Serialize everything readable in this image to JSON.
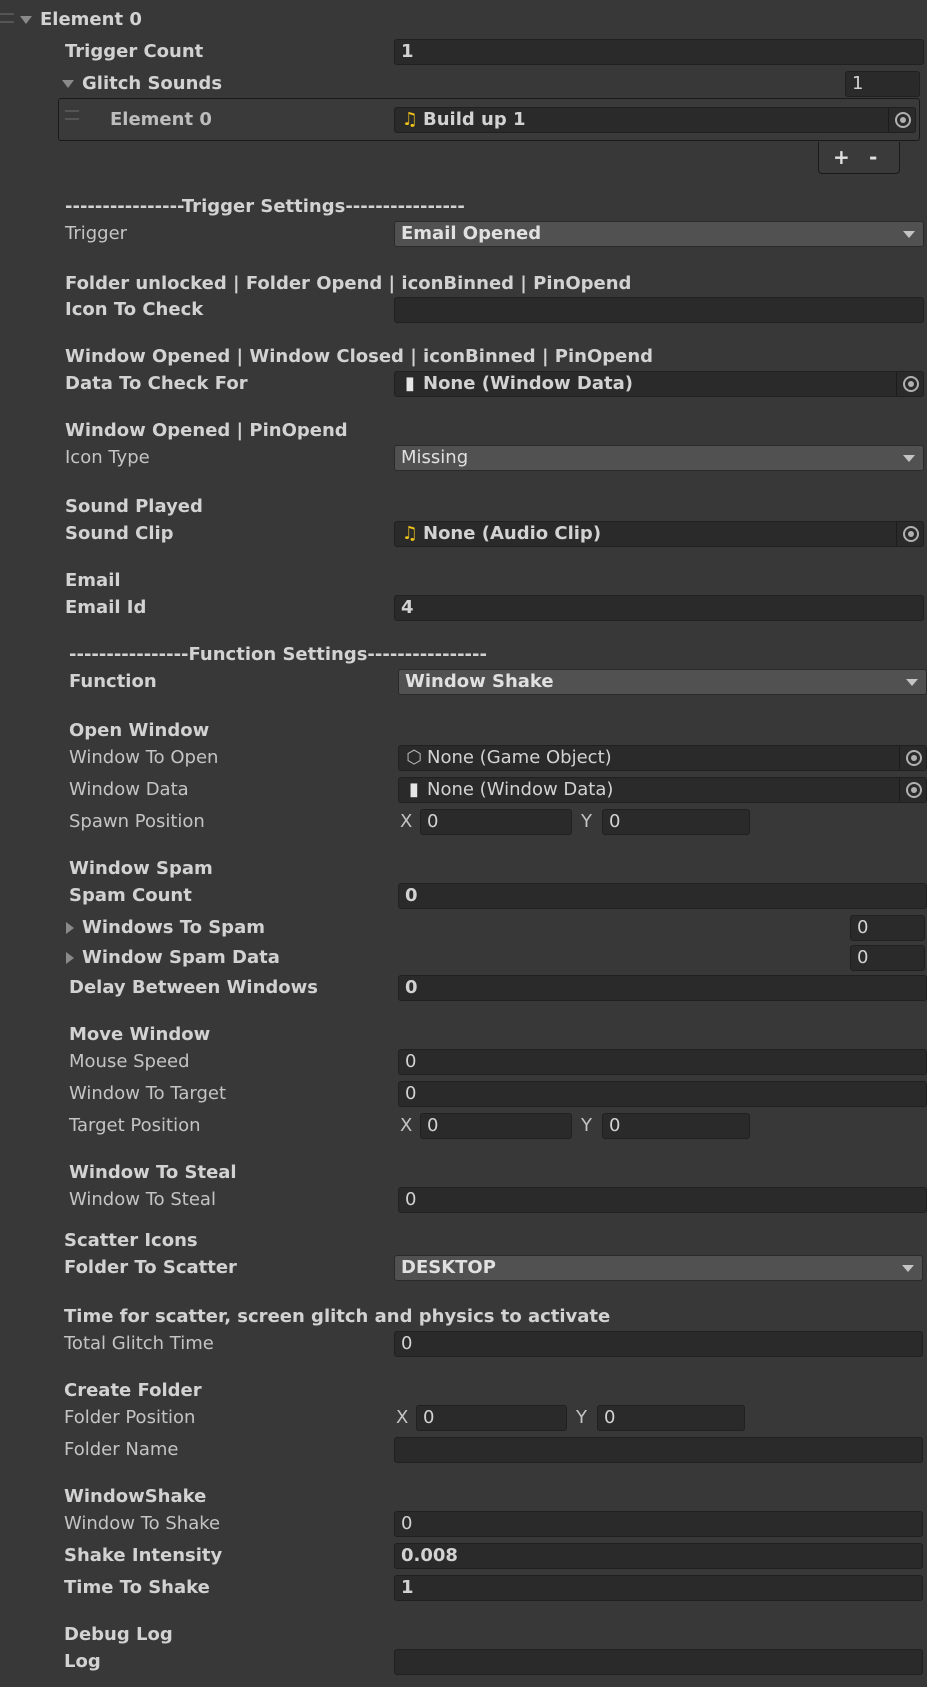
{
  "element_root": {
    "label": "Element 0"
  },
  "trigger_count": {
    "label": "Trigger Count",
    "value": "1"
  },
  "glitch_sounds": {
    "label": "Glitch Sounds",
    "size": "1",
    "element": {
      "label": "Element 0",
      "value": "Build up 1",
      "icon": "music-note-icon"
    },
    "add_label": "+",
    "remove_label": "-"
  },
  "trigger_settings_header": "----------------Trigger Settings----------------",
  "trigger": {
    "label": "Trigger",
    "value": "Email Opened"
  },
  "folder_section": {
    "header": "Folder unlocked | Folder Opend | iconBinned | PinOpend",
    "label": "Icon To Check",
    "value": ""
  },
  "window_section": {
    "header": "Window Opened | Window Closed | iconBinned | PinOpend",
    "label": "Data To Check For",
    "value": "None (Window Data)",
    "icon": "document-icon"
  },
  "icon_type_section": {
    "header": "Window Opened | PinOpend",
    "label": "Icon Type",
    "value": "Missing"
  },
  "sound_section": {
    "header": "Sound Played",
    "label": "Sound Clip",
    "value": "None (Audio Clip)",
    "icon": "music-note-icon"
  },
  "email_section": {
    "header": "Email",
    "label": "Email Id",
    "value": "4"
  },
  "function_settings_header": "----------------Function Settings----------------",
  "function": {
    "label": "Function",
    "value": "Window Shake"
  },
  "open_window": {
    "header": "Open Window",
    "window_to_open": {
      "label": "Window To Open",
      "value": "None (Game Object)",
      "icon": "cube-icon"
    },
    "window_data": {
      "label": "Window Data",
      "value": "None (Window Data)",
      "icon": "document-icon"
    },
    "spawn_position": {
      "label": "Spawn Position",
      "x_label": "X",
      "x": "0",
      "y_label": "Y",
      "y": "0"
    }
  },
  "window_spam": {
    "header": "Window Spam",
    "spam_count": {
      "label": "Spam Count",
      "value": "0"
    },
    "windows_to_spam": {
      "label": "Windows To Spam",
      "size": "0"
    },
    "window_spam_data": {
      "label": "Window Spam Data",
      "size": "0"
    },
    "delay": {
      "label": "Delay Between Windows",
      "value": "0"
    }
  },
  "move_window": {
    "header": "Move Window",
    "mouse_speed": {
      "label": "Mouse Speed",
      "value": "0"
    },
    "window_to_target": {
      "label": "Window To Target",
      "value": "0"
    },
    "target_position": {
      "label": "Target Position",
      "x_label": "X",
      "x": "0",
      "y_label": "Y",
      "y": "0"
    }
  },
  "window_to_steal": {
    "header": "Window To Steal",
    "field": {
      "label": "Window To Steal",
      "value": "0"
    }
  },
  "scatter_icons": {
    "header": "Scatter Icons",
    "label": "Folder To Scatter",
    "value": "DESKTOP"
  },
  "glitch_time": {
    "header": "Time for scatter, screen glitch and physics to activate",
    "label": "Total Glitch Time",
    "value": "0"
  },
  "create_folder": {
    "header": "Create Folder",
    "folder_position": {
      "label": "Folder Position",
      "x_label": "X",
      "x": "0",
      "y_label": "Y",
      "y": "0"
    },
    "folder_name": {
      "label": "Folder Name",
      "value": ""
    }
  },
  "window_shake": {
    "header": "WindowShake",
    "window_to_shake": {
      "label": "Window To Shake",
      "value": "0"
    },
    "shake_intensity": {
      "label": "Shake Intensity",
      "value": "0.008"
    },
    "time_to_shake": {
      "label": "Time To Shake",
      "value": "1"
    }
  },
  "debug_log": {
    "header": "Debug Log",
    "label": "Log",
    "value": ""
  }
}
